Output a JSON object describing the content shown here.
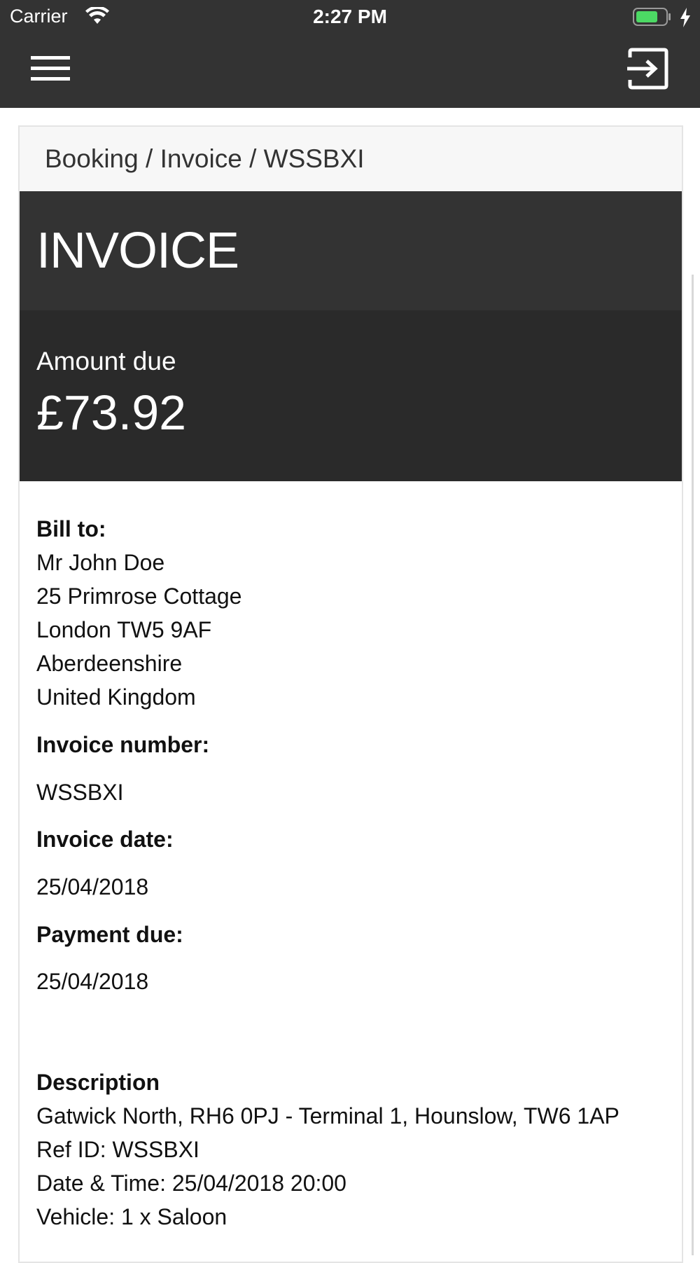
{
  "status_bar": {
    "carrier": "Carrier",
    "time": "2:27 PM",
    "battery_color": "#4cd964"
  },
  "nav": {
    "menu_icon": "hamburger-menu-icon",
    "logout_icon": "logout-icon"
  },
  "breadcrumb": {
    "items": [
      "Booking",
      "Invoice",
      "WSSBXI"
    ],
    "separator": " / "
  },
  "invoice": {
    "title": "INVOICE",
    "amount_label": "Amount due",
    "amount_value": "£73.92"
  },
  "bill_to": {
    "label": "Bill to:",
    "lines": [
      "Mr John Doe",
      "25 Primrose Cottage",
      "London TW5 9AF",
      "Aberdeenshire",
      "United Kingdom"
    ]
  },
  "invoice_number": {
    "label": "Invoice number:",
    "value": "WSSBXI"
  },
  "invoice_date": {
    "label": "Invoice date:",
    "value": "25/04/2018"
  },
  "payment_due": {
    "label": "Payment due:",
    "value": "25/04/2018"
  },
  "description": {
    "label": "Description",
    "lines": [
      "Gatwick North, RH6 0PJ - Terminal 1, Hounslow, TW6 1AP",
      "Ref ID: WSSBXI",
      "Date & Time: 25/04/2018 20:00",
      "Vehicle: 1 x Saloon"
    ]
  },
  "colors": {
    "header_dark": "#333333",
    "panel_dark": "#2a2a2a",
    "breadcrumb_bg": "#f7f7f7"
  }
}
